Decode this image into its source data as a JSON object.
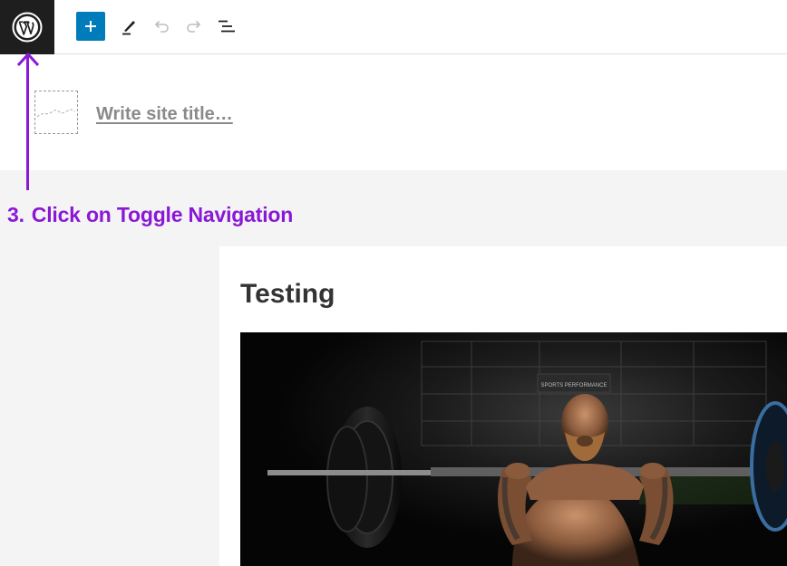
{
  "toolbar": {
    "logo_icon": "wordpress-icon",
    "add_icon": "plus-icon",
    "edit_icon": "pencil-icon",
    "undo_icon": "undo-icon",
    "redo_icon": "redo-icon",
    "list_icon": "list-view-icon",
    "accent_color": "#007cba"
  },
  "site_header": {
    "logo_icon": "site-logo-placeholder-icon",
    "title_placeholder": "Write site title…"
  },
  "annotation": {
    "number": "3.",
    "text": "Click on Toggle Navigation",
    "color": "#8a18d6"
  },
  "post": {
    "title": "Testing",
    "image_icon": "weightlifter-photo",
    "image_text": "SPORTS PERFORMANCE"
  }
}
